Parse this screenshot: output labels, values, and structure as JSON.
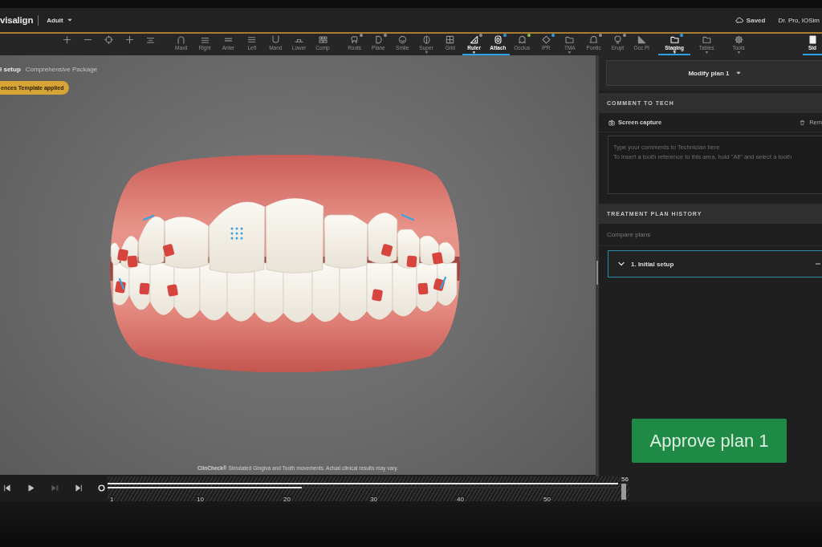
{
  "header": {
    "logo": "visalign",
    "patient_type": "Adult",
    "save_status": "Saved",
    "user": "Dr. Pro, IOSim"
  },
  "toolbar": {
    "groups": [
      {
        "items": [
          {
            "selected": false,
            "has_menu": false
          },
          {
            "selected": false,
            "has_menu": false
          },
          {
            "selected": false,
            "has_menu": false
          },
          {
            "selected": false,
            "has_menu": false
          },
          {
            "selected": false,
            "has_menu": false
          }
        ]
      },
      {
        "items": [
          {
            "label": "Maxil",
            "selected": false,
            "has_menu": false
          },
          {
            "label": "Right",
            "selected": false,
            "has_menu": false
          },
          {
            "label": "Anter",
            "selected": false,
            "has_menu": false
          },
          {
            "label": "Left",
            "selected": false,
            "has_menu": false
          },
          {
            "label": "Mand",
            "selected": false,
            "has_menu": false
          },
          {
            "label": "Lower",
            "selected": false,
            "has_menu": false
          },
          {
            "label": "Comp",
            "selected": false,
            "has_menu": false
          }
        ]
      },
      {
        "items": [
          {
            "label": "Roots",
            "selected": false,
            "has_menu": false,
            "color": "#8c8c8c"
          },
          {
            "label": "Plane",
            "selected": false,
            "has_menu": false,
            "color": "#8c8c8c"
          },
          {
            "label": "Smile",
            "selected": false,
            "has_menu": false
          },
          {
            "label": "Super",
            "selected": false,
            "has_menu": true
          },
          {
            "label": "Grid",
            "selected": false,
            "has_menu": false
          },
          {
            "label": "Ruler",
            "selected": true,
            "has_menu": true,
            "color": "#8c8c8c"
          },
          {
            "label": "Attach",
            "selected": true,
            "has_menu": false,
            "color": "#2e9fd8"
          },
          {
            "label": "Occlus",
            "selected": false,
            "has_menu": false,
            "color": "#86c440"
          },
          {
            "label": "IPR",
            "selected": false,
            "has_menu": false,
            "color": "#2e9fd8"
          },
          {
            "label": "TMA",
            "selected": false,
            "has_menu": true
          },
          {
            "label": "Pontic",
            "selected": false,
            "has_menu": false,
            "color": "#8c8c8c"
          },
          {
            "label": "Erupt",
            "selected": false,
            "has_menu": false,
            "color": "#8c8c8c"
          },
          {
            "label": "Occ Pl",
            "selected": false,
            "has_menu": false
          }
        ]
      },
      {
        "items": [
          {
            "label": "Staging",
            "selected": true,
            "has_menu": true,
            "color": "#2e9fd8"
          },
          {
            "label": "Tables",
            "selected": false,
            "has_menu": true
          },
          {
            "label": "Tools",
            "selected": false,
            "has_menu": true
          }
        ]
      },
      {
        "items": [
          {
            "label": "Sid",
            "selected": true,
            "has_menu": false
          }
        ]
      }
    ]
  },
  "viewport": {
    "setup_title": "l setup",
    "package": "Comprehensive Package",
    "template_badge": "ences Template applied",
    "disclaimer": "**ClinCheck®** Simulated Gingiva and Tooth movements. Actual clinical results may vary."
  },
  "timeline": {
    "controls": [
      {
        "kind": "skip_start",
        "disabled": false
      },
      {
        "kind": "play",
        "disabled": false
      },
      {
        "kind": "step_forward",
        "disabled": true
      },
      {
        "kind": "skip_end",
        "disabled": false
      }
    ],
    "level": 0.38,
    "ticks": [
      "1",
      "10",
      "20",
      "30",
      "40",
      "50"
    ],
    "end_label": "56"
  },
  "right_panel": {
    "plan_dropdown": "Modify plan 1",
    "comment_section": {
      "title": "COMMENT TO TECH",
      "screen_capture": "Screen capture",
      "remove": "Rem",
      "placeholder": "Type your comments to Technician here\nTo insert a tooth reference to this area, hold \"Alt\" and select a tooth"
    },
    "history_section": {
      "title": "TREATMENT PLAN HISTORY",
      "compare": {
        "label": "Compare plans",
        "disabled": true
      },
      "plans": [
        {
          "label": "1. Initial setup",
          "expanded": true,
          "selected": true
        }
      ]
    },
    "approve_button": "Approve plan 1"
  }
}
